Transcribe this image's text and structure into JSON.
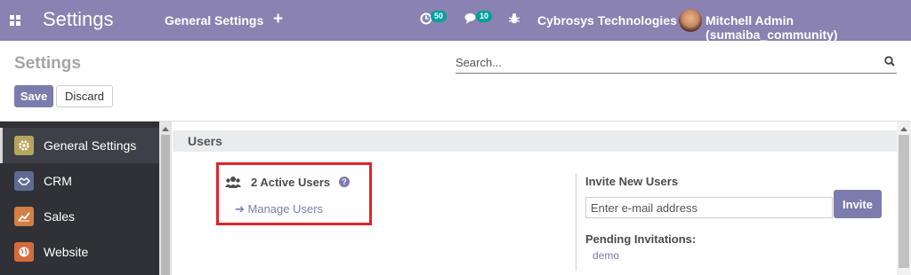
{
  "navbar": {
    "app_title": "Settings",
    "menu_item": "General Settings",
    "plus_label": "+",
    "activity_count": "50",
    "messages_count": "10",
    "company": "Cybrosys Technologies",
    "user": "Mitchell Admin (sumaiba_community)"
  },
  "control_panel": {
    "title": "Settings",
    "search_placeholder": "Search...",
    "save_label": "Save",
    "discard_label": "Discard"
  },
  "sidebar": {
    "items": [
      {
        "label": "General Settings",
        "icon": "gear-icon",
        "color": "#b6a55c"
      },
      {
        "label": "CRM",
        "icon": "handshake-icon",
        "color": "#5e6b8f"
      },
      {
        "label": "Sales",
        "icon": "chart-icon",
        "color": "#d37f45"
      },
      {
        "label": "Website",
        "icon": "globe-icon",
        "color": "#d66b3b"
      }
    ]
  },
  "users_section": {
    "title": "Users",
    "active_users": "2 Active Users",
    "manage_users": "Manage Users",
    "invite_label": "Invite New Users",
    "invite_placeholder": "Enter e-mail address",
    "invite_button": "Invite",
    "pending_label": "Pending Invitations:",
    "pending": [
      "demo"
    ]
  },
  "colors": {
    "navbar": "#8a82b1",
    "primary": "#7c7bad",
    "highlight": "#e0232b",
    "badge": "#00a09d"
  }
}
